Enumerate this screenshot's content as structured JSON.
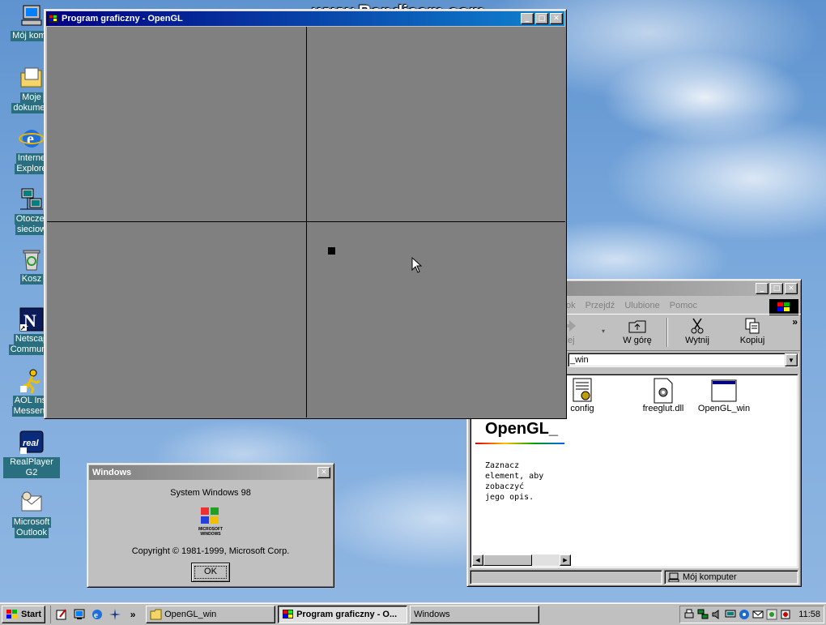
{
  "watermark": "www.Bandicam.com",
  "desktop_icons": [
    {
      "label_1": "Mój komp",
      "label_2": ""
    },
    {
      "label_1": "Moje",
      "label_2": "dokumen"
    },
    {
      "label_1": "Interne",
      "label_2": "Explore"
    },
    {
      "label_1": "Otoczer",
      "label_2": "sieciow"
    },
    {
      "label_1": "Kosz",
      "label_2": ""
    },
    {
      "label_1": "Netscap",
      "label_2": "Communic"
    },
    {
      "label_1": "AOL Inst",
      "label_2": "Messeng"
    },
    {
      "label_1": "RealPlayer G2",
      "label_2": ""
    },
    {
      "label_1": "Microsoft",
      "label_2": "Outlook"
    }
  ],
  "program_window": {
    "title": "Program graficzny - OpenGL",
    "minimize": "_",
    "maximize": "□",
    "close": "✕"
  },
  "explorer": {
    "menu": [
      "ok",
      "Przejdź",
      "Ulubione",
      "Pomoc"
    ],
    "tools": [
      {
        "label": "alej"
      },
      {
        "label": "W górę"
      },
      {
        "label": "Wytnij"
      },
      {
        "label": "Kopiuj"
      }
    ],
    "more": "»",
    "address": "_win",
    "files": [
      {
        "label": "config"
      },
      {
        "label": "freeglut.dll"
      },
      {
        "label": "OpenGL_win"
      }
    ],
    "folder_title": "OpenGL_",
    "description": [
      "Zaznacz",
      "element, aby",
      "zobaczyć",
      "jego opis."
    ],
    "status": "Mój komputer"
  },
  "about_dialog": {
    "title": "Windows",
    "product": "System Windows 98",
    "logo_text_1": "MICROSOFT",
    "logo_text_2": "WINDOWS",
    "copyright": "Copyright © 1981-1999, Microsoft Corp.",
    "ok": "OK"
  },
  "taskbar": {
    "start": "Start",
    "chevron": "»",
    "tasks": [
      {
        "label": "OpenGL_win",
        "active": false
      },
      {
        "label": "Program graficzny - O...",
        "active": true
      },
      {
        "label": "Windows",
        "active": false
      }
    ],
    "clock": "11:58"
  }
}
